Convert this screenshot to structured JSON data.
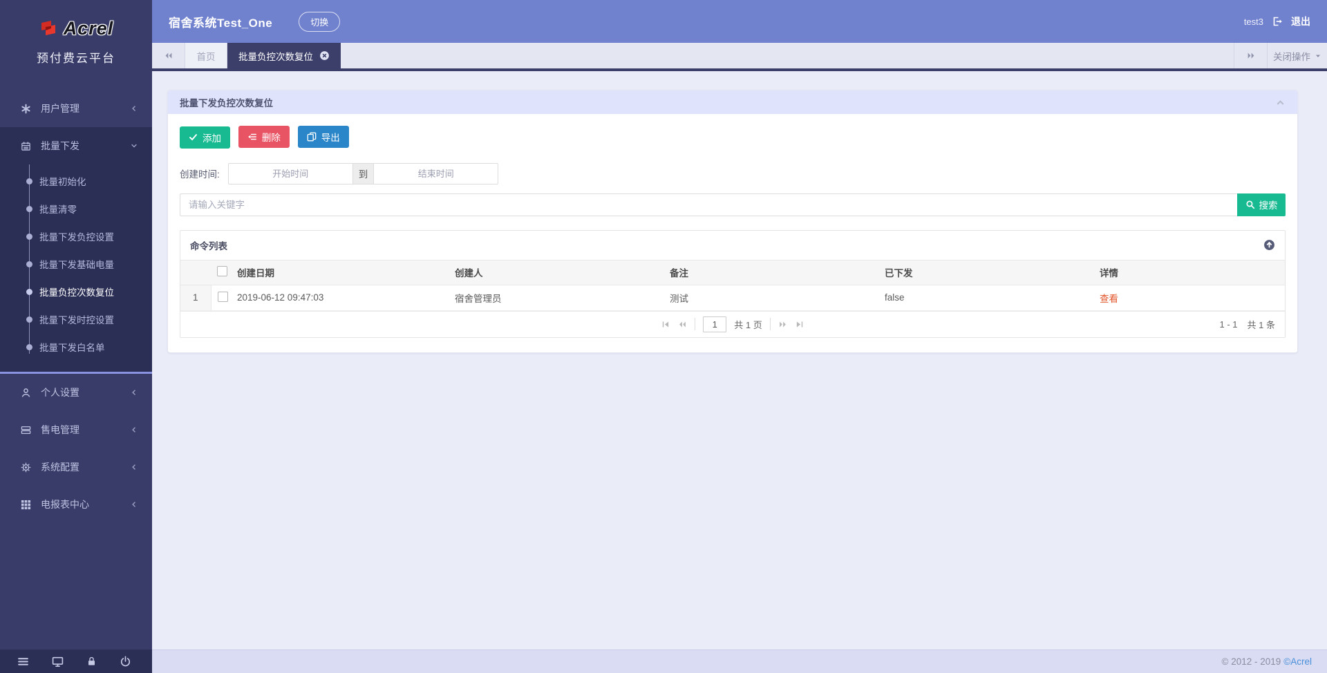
{
  "colors": {
    "topbar": "#7081ce",
    "sidebar": "#393c68",
    "sidebar_expanded": "#2b2e55",
    "active_tab": "#3c3f6a",
    "green": "#18ba92",
    "red": "#e85464",
    "blue": "#2a86c8",
    "detail_link": "#e4572e",
    "footer_bg": "#d9dcf2"
  },
  "sidebar": {
    "brand": "Acrel",
    "subtitle": "预付费云平台",
    "menu": [
      {
        "label": "用户管理",
        "icon": "asterisk-icon"
      },
      {
        "label": "批量下发",
        "icon": "calendar-icon",
        "expanded": true,
        "children": [
          "批量初始化",
          "批量清零",
          "批量下发负控设置",
          "批量下发基础电量",
          "批量负控次数复位",
          "批量下发时控设置",
          "批量下发白名单"
        ],
        "active_child": "批量负控次数复位"
      },
      {
        "label": "个人设置",
        "icon": "user-icon"
      },
      {
        "label": "售电管理",
        "icon": "cards-icon"
      },
      {
        "label": "系统配置",
        "icon": "gear-icon"
      },
      {
        "label": "电报表中心",
        "icon": "grid-icon"
      }
    ],
    "bottom_icons": [
      "menu-icon",
      "monitor-icon",
      "lock-icon",
      "power-icon"
    ]
  },
  "topbar": {
    "title": "宿舍系统Test_One",
    "switch_label": "切换",
    "username": "test3",
    "logout_label": "退出"
  },
  "tabbar": {
    "home_tab": "首页",
    "active_tab": "批量负控次数复位",
    "close_ops_label": "关闭操作"
  },
  "panel": {
    "title": "批量下发负控次数复位",
    "toolbar": {
      "add_label": "添加",
      "delete_label": "删除",
      "export_label": "导出"
    },
    "filter": {
      "label": "创建时间:",
      "start_placeholder": "开始时间",
      "to_label": "到",
      "end_placeholder": "结束时间"
    },
    "search": {
      "placeholder": "请输入关键字",
      "button_label": "搜索"
    },
    "list": {
      "title": "命令列表",
      "columns": [
        "创建日期",
        "创建人",
        "备注",
        "已下发",
        "详情"
      ],
      "rows": [
        {
          "index": "1",
          "date": "2019-06-12 09:47:03",
          "creator": "宿舍管理员",
          "remark": "测试",
          "sent": "false",
          "detail": "查看"
        }
      ],
      "pagination": {
        "page": "1",
        "pages_label": "共 1 页",
        "range": "1 - 1",
        "total": "共 1 条"
      }
    }
  },
  "footer": {
    "copyright": "© 2012 - 2019",
    "brand_link": "©Acrel"
  }
}
